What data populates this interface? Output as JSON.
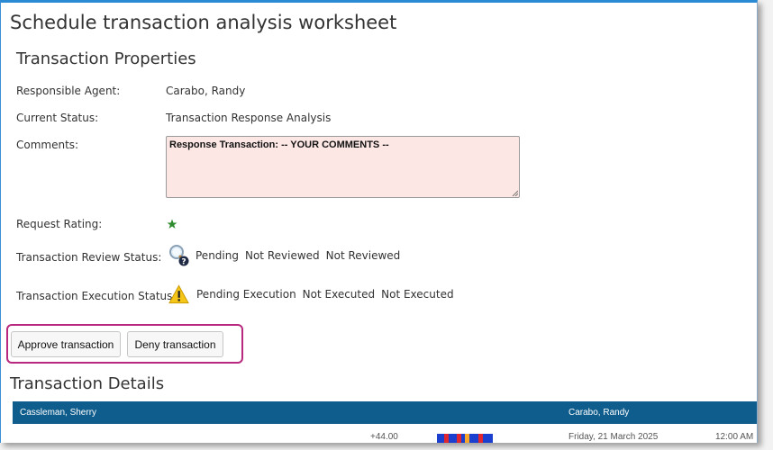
{
  "page": {
    "title": "Schedule transaction analysis worksheet"
  },
  "properties": {
    "heading": "Transaction Properties",
    "responsible_agent": {
      "label": "Responsible Agent:",
      "value": "Carabo, Randy"
    },
    "current_status": {
      "label": "Current Status:",
      "value": "Transaction Response Analysis"
    },
    "comments": {
      "label": "Comments:",
      "value": "Response Transaction: -- YOUR COMMENTS --"
    },
    "request_rating": {
      "label": "Request Rating:",
      "icon": "star-icon",
      "color": "#2e8b2e"
    },
    "review_status": {
      "label": "Transaction Review Status:",
      "icon": "magnifier-question-icon",
      "status": "Pending",
      "v1": "Not Reviewed",
      "v2": "Not Reviewed"
    },
    "execution_status": {
      "label": "Transaction Execution Status:",
      "icon": "warning-icon",
      "status": "Pending Execution",
      "v1": "Not Executed",
      "v2": "Not Executed"
    }
  },
  "actions": {
    "approve_label": "Approve transaction",
    "deny_label": "Deny transaction",
    "highlight_color": "#b8287e"
  },
  "details": {
    "heading": "Transaction Details",
    "header_color": "#0f5d8c",
    "header": {
      "left": "Cassleman, Sherry",
      "right": "Carabo, Randy"
    },
    "row": {
      "amount": "+44.00",
      "date": "Friday, 21 March 2025",
      "time": "12:00 AM"
    }
  }
}
